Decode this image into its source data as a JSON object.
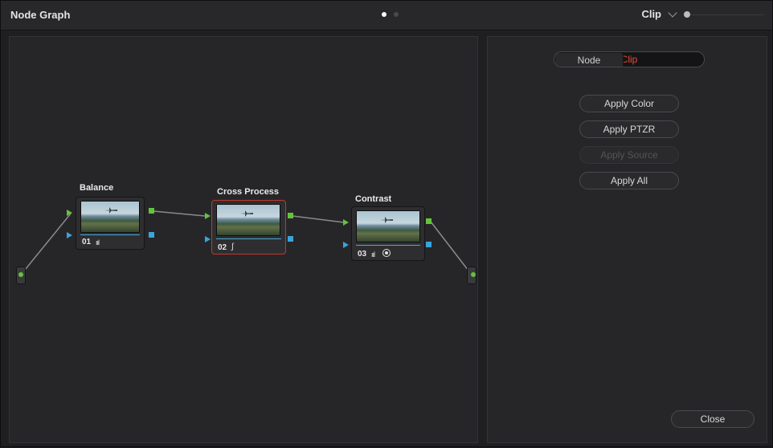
{
  "header": {
    "title": "Node Graph",
    "mode_label": "Clip"
  },
  "nodes": [
    {
      "label": "Balance",
      "number": "01",
      "selected": false,
      "icons": [
        "bars-icon"
      ]
    },
    {
      "label": "Cross Process",
      "number": "02",
      "selected": true,
      "icons": [
        "curves-icon"
      ]
    },
    {
      "label": "Contrast",
      "number": "03",
      "selected": false,
      "icons": [
        "bars-icon",
        "target-icon"
      ]
    }
  ],
  "panel": {
    "segment": {
      "options": [
        "Node",
        "Clip"
      ],
      "selected": "Clip"
    },
    "buttons": {
      "apply_color": "Apply Color",
      "apply_ptzr": "Apply PTZR",
      "apply_source": "Apply Source",
      "apply_all": "Apply All",
      "close": "Close"
    }
  },
  "colors": {
    "accent_red": "#e64b3c",
    "rgb_port": "#62c43a",
    "key_port": "#3aa4dc",
    "selected_border": "#c0392b"
  }
}
